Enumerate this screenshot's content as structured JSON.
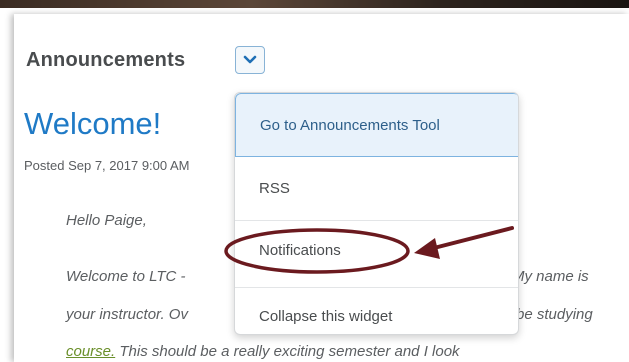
{
  "widget": {
    "title": "Announcements",
    "menu_toggle_icon": "chevron-down-icon"
  },
  "announcement": {
    "heading": "Welcome!",
    "posted": "Posted Sep 7, 2017 9:00 AM",
    "greeting": "Hello Paige,",
    "line2_left": "Welcome to LTC - ",
    "line2_right": "My name is",
    "line3_left": "your instructor. Ov",
    "line3_right": "be studying",
    "line4_link": "course.",
    "line4_rest": " This should be a really exciting semester and I look"
  },
  "dropdown": {
    "items": [
      {
        "label": "Go to Announcements Tool"
      },
      {
        "label": "RSS"
      },
      {
        "label": "Notifications"
      },
      {
        "label": "Collapse this widget"
      }
    ]
  },
  "annotation": {
    "color": "#6b1a1f"
  },
  "colors": {
    "heading": "#1f7ac6",
    "accent_border": "#7db3e0",
    "link": "#6a8f2a"
  }
}
